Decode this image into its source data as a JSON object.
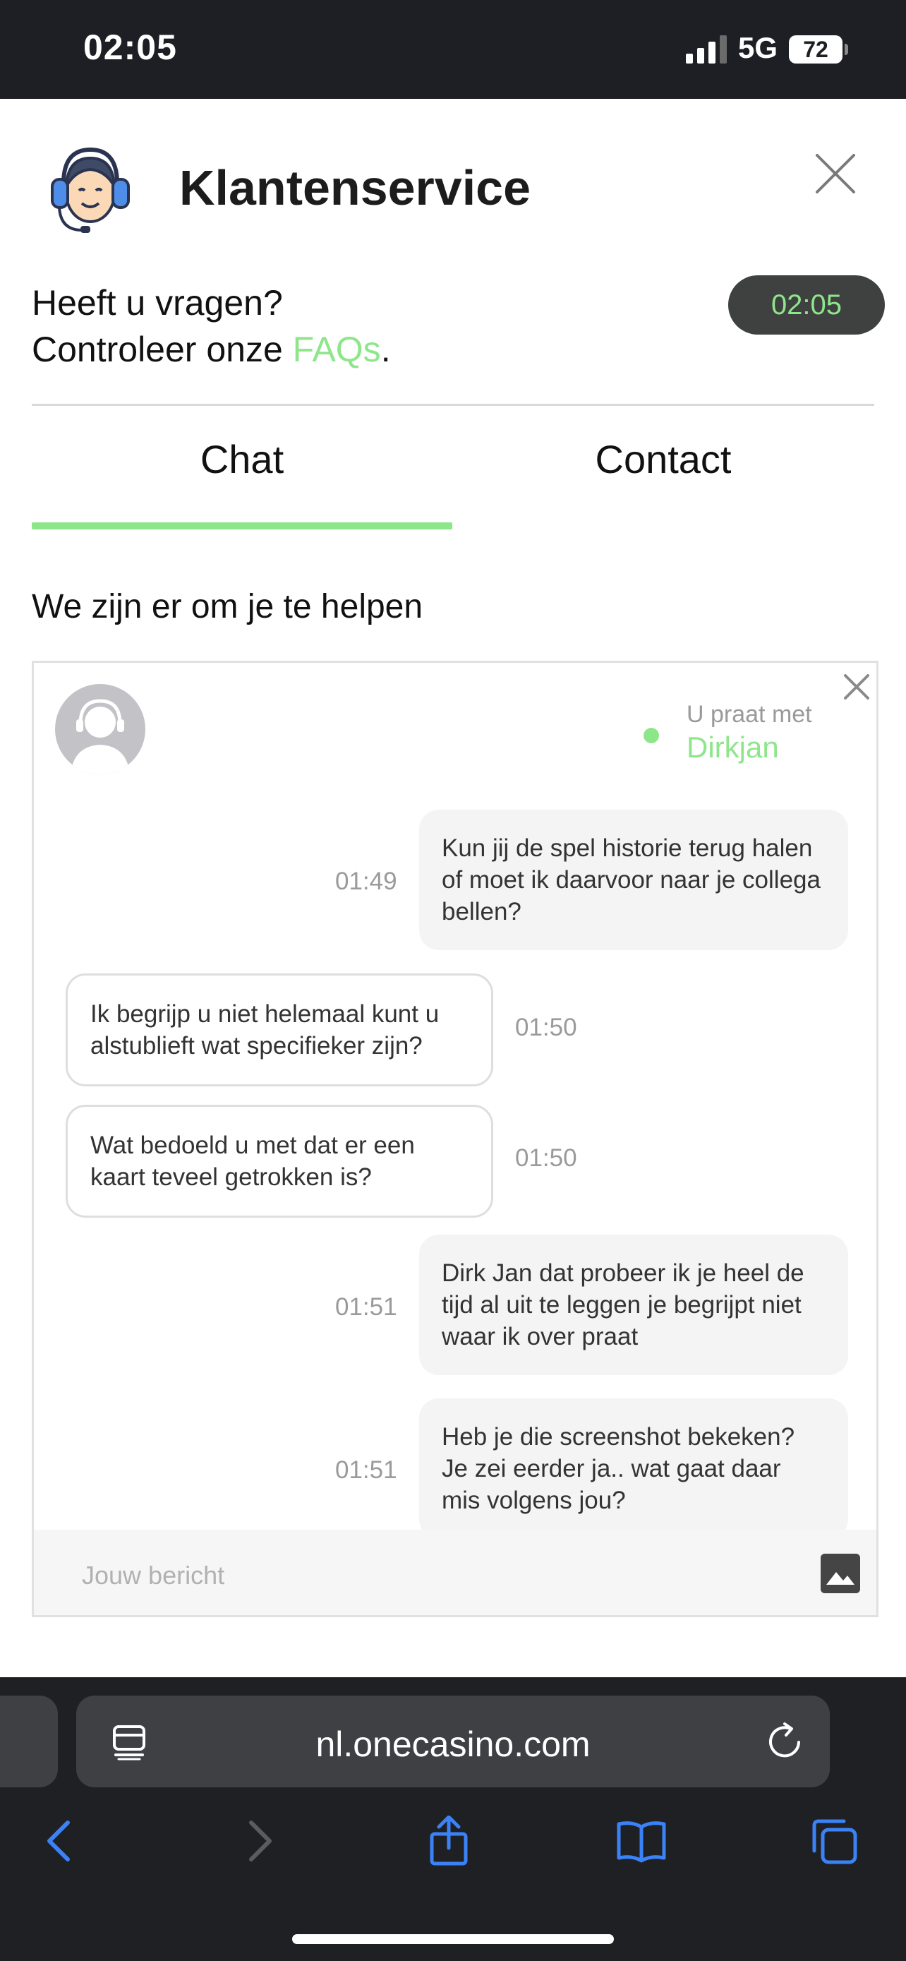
{
  "status_bar": {
    "time": "02:05",
    "network": "5G",
    "battery": "72"
  },
  "header": {
    "title": "Klantenservice"
  },
  "faq": {
    "line1": "Heeft u vragen?",
    "line2_prefix": "Controleer onze ",
    "link": "FAQs",
    "line2_suffix": "."
  },
  "timer": "02:05",
  "tabs": [
    {
      "label": "Chat",
      "active": true
    },
    {
      "label": "Contact",
      "active": false
    }
  ],
  "helper_text": "We zijn er om je te helpen",
  "chat": {
    "talking_label": "U praat met",
    "agent_name": "Dirkjan",
    "messages": [
      {
        "direction": "out",
        "time": "01:49",
        "text": "Kun jij de spel historie terug halen of moet ik daarvoor naar je collega bellen?"
      },
      {
        "direction": "in",
        "time": "01:50",
        "text": "Ik begrijp u niet helemaal kunt u alstublieft wat specifieker zijn?"
      },
      {
        "direction": "in",
        "time": "01:50",
        "text": "Wat bedoeld u met dat er een kaart teveel getrokken is?"
      },
      {
        "direction": "out",
        "time": "01:51",
        "text": "Dirk Jan dat probeer ik je heel de tijd al uit te leggen je begrijpt niet waar ik over praat"
      },
      {
        "direction": "out",
        "time": "01:51",
        "text": "Heb je die screenshot bekeken? Je zei eerder ja.. wat gaat daar mis volgens jou?"
      }
    ],
    "input_placeholder": "Jouw bericht"
  },
  "browser": {
    "url": "nl.onecasino.com"
  },
  "colors": {
    "accent": "#8ee68b",
    "status_bar": "#1d1f24",
    "browser_bar": "#1e2024",
    "ios_blue": "#3b82f6"
  }
}
